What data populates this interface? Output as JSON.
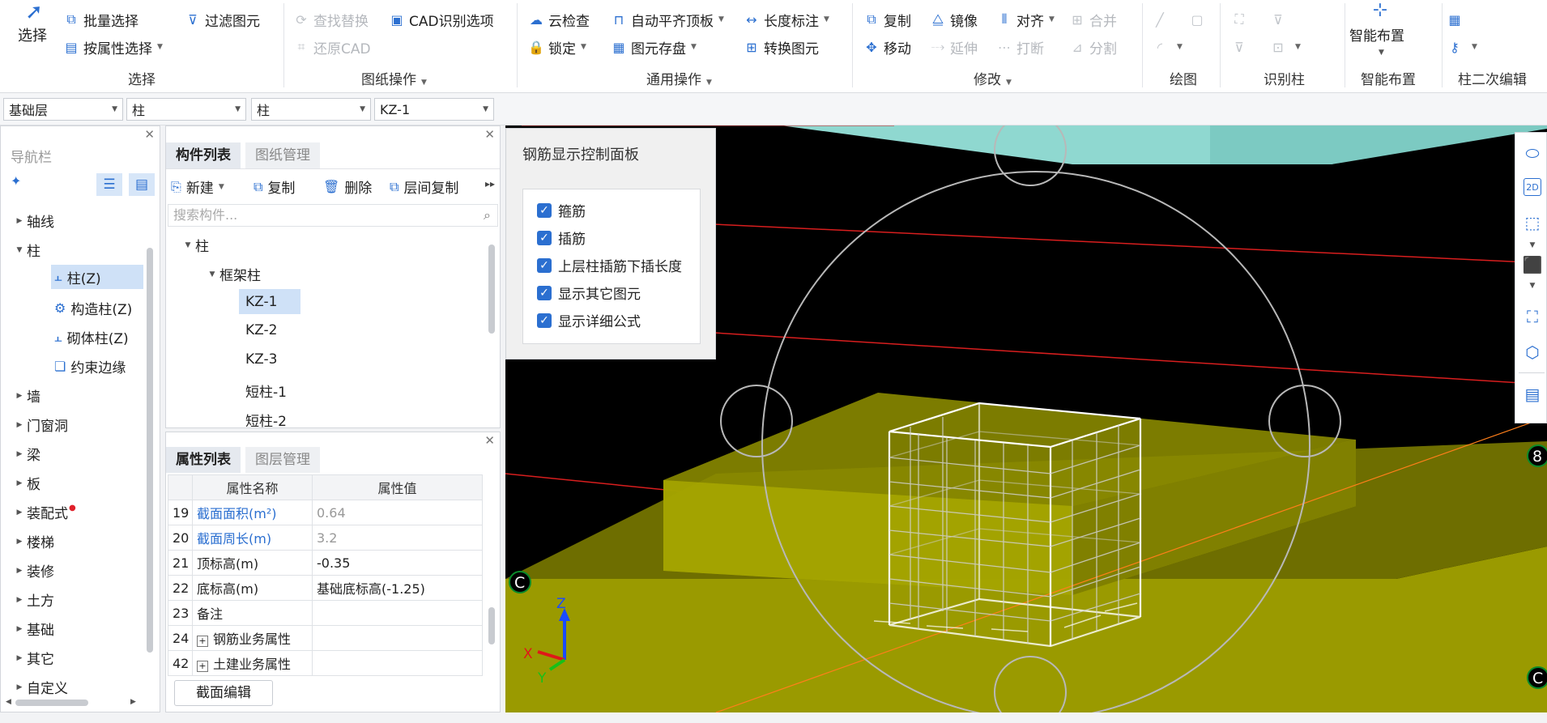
{
  "ribbon": {
    "select": {
      "big_label": "选择",
      "batch": "批量选择",
      "filter": "过滤图元",
      "by_attr": "按属性选择",
      "group": "选择"
    },
    "drawing": {
      "find_replace": "查找替换",
      "cad_options": "CAD识别选项",
      "restore_cad": "还原CAD",
      "group": "图纸操作"
    },
    "general": {
      "cloud_check": "云检查",
      "auto_flush": "自动平齐顶板",
      "length_dim": "长度标注",
      "lock": "锁定",
      "save_elem": "图元存盘",
      "convert": "转换图元",
      "group": "通用操作"
    },
    "modify": {
      "copy": "复制",
      "mirror": "镜像",
      "align": "对齐",
      "merge": "合并",
      "move": "移动",
      "extend": "延伸",
      "break": "打断",
      "split": "分割",
      "group": "修改"
    },
    "draw": {
      "group": "绘图"
    },
    "recognize": {
      "group": "识别柱"
    },
    "smart": {
      "label": "智能布置",
      "group": "智能布置"
    },
    "secondary": {
      "group": "柱二次编辑"
    }
  },
  "selectors": [
    "基础层",
    "柱",
    "柱",
    "KZ-1"
  ],
  "nav": {
    "title": "导航栏",
    "items": [
      "轴线",
      "柱",
      "柱(Z)",
      "构造柱(Z)",
      "砌体柱(Z)",
      "约束边缘",
      "墙",
      "门窗洞",
      "梁",
      "板",
      "装配式",
      "楼梯",
      "装修",
      "土方",
      "基础",
      "其它",
      "自定义"
    ]
  },
  "components": {
    "tabs": [
      "构件列表",
      "图纸管理"
    ],
    "toolbar": {
      "new": "新建",
      "copy": "复制",
      "delete": "删除",
      "floor_copy": "层间复制"
    },
    "search_placeholder": "搜索构件...",
    "tree": {
      "root": "柱",
      "group": "框架柱",
      "items": [
        "KZ-1",
        "KZ-2",
        "KZ-3",
        "短柱-1",
        "短柱-2"
      ]
    }
  },
  "properties": {
    "tabs": [
      "属性列表",
      "图层管理"
    ],
    "headers": [
      "属性名称",
      "属性值"
    ],
    "rows": [
      {
        "no": "19",
        "name": "截面面积(m²)",
        "value": "0.64"
      },
      {
        "no": "20",
        "name": "截面周长(m)",
        "value": "3.2"
      },
      {
        "no": "21",
        "name": "顶标高(m)",
        "value": "-0.35"
      },
      {
        "no": "22",
        "name": "底标高(m)",
        "value": "基础底标高(-1.25)"
      },
      {
        "no": "23",
        "name": "备注",
        "value": ""
      },
      {
        "no": "24",
        "name": "钢筋业务属性",
        "value": ""
      },
      {
        "no": "42",
        "name": "土建业务属性",
        "value": ""
      }
    ],
    "section_edit": "截面编辑"
  },
  "rebar_panel": {
    "title": "钢筋显示控制面板",
    "options": [
      "箍筋",
      "插筋",
      "上层柱插筋下插长度",
      "显示其它图元",
      "显示详细公式"
    ]
  },
  "viewport": {
    "axis_labels": [
      "C",
      "8",
      "C"
    ],
    "axes": [
      "X",
      "Y",
      "Z"
    ]
  },
  "colors": {
    "accent": "#2b6fd0",
    "foundation": "#9a9a00",
    "slab": "#8fd8d0",
    "axis_line": "#d81e1e",
    "cage": "#ffffff"
  }
}
